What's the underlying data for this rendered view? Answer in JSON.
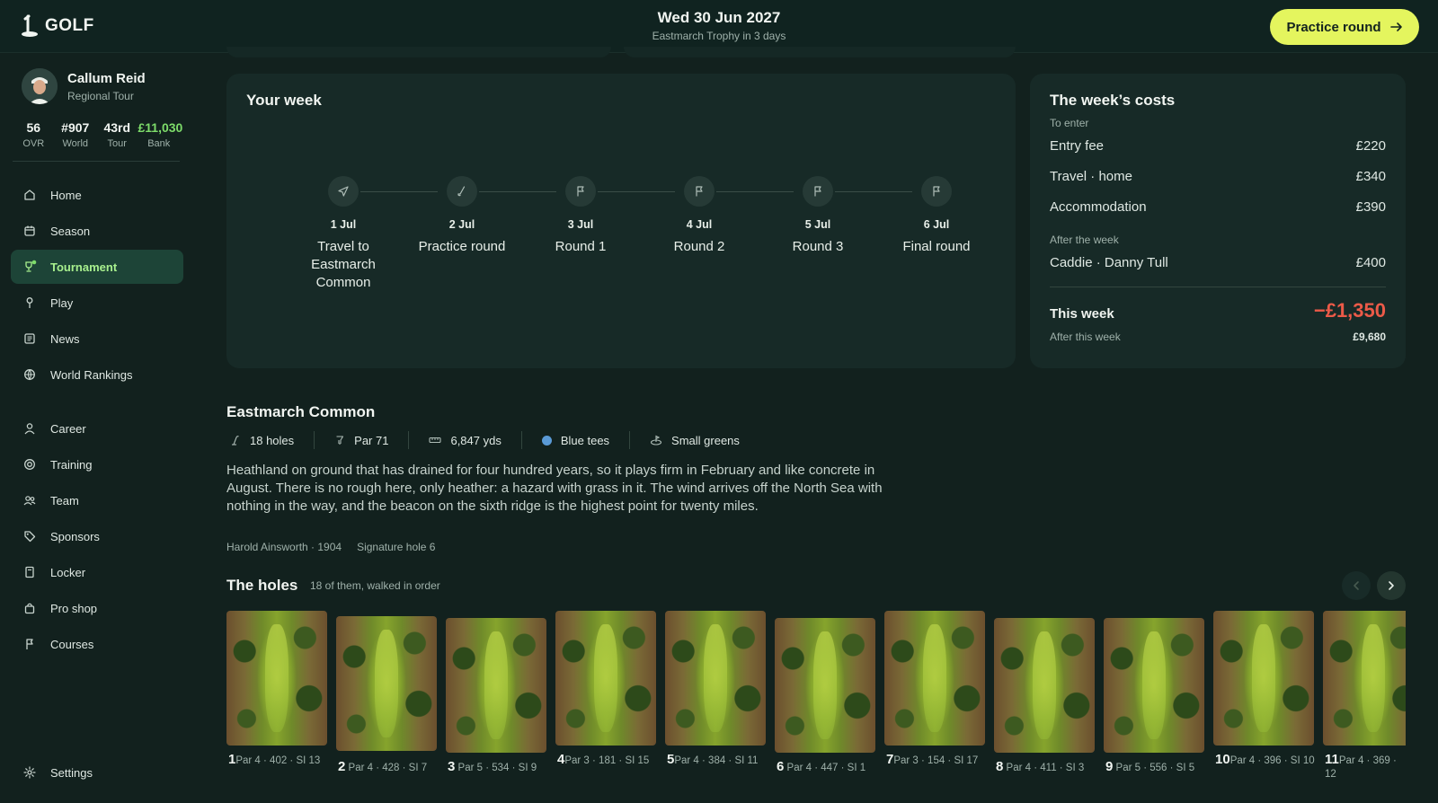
{
  "app": {
    "logo_text": "GOLF"
  },
  "header": {
    "date": "Wed 30 Jun 2027",
    "subtitle": "Eastmarch Trophy in 3 days",
    "cta_label": "Practice round"
  },
  "profile": {
    "name": "Callum Reid",
    "tour": "Regional Tour",
    "stats": [
      {
        "value": "56",
        "label": "OVR"
      },
      {
        "value": "#907",
        "label": "World"
      },
      {
        "value": "43rd",
        "label": "Tour"
      },
      {
        "value": "£11,030",
        "label": "Bank"
      }
    ]
  },
  "nav": {
    "items": [
      {
        "label": "Home",
        "icon": "home-icon"
      },
      {
        "label": "Season",
        "icon": "calendar-icon"
      },
      {
        "label": "Tournament",
        "icon": "trophy-icon",
        "active": true
      },
      {
        "label": "Play",
        "icon": "tee-icon"
      },
      {
        "label": "News",
        "icon": "newspaper-icon"
      },
      {
        "label": "World Rankings",
        "icon": "globe-icon"
      },
      {
        "label": "Career",
        "icon": "user-icon"
      },
      {
        "label": "Training",
        "icon": "target-icon"
      },
      {
        "label": "Team",
        "icon": "users-icon"
      },
      {
        "label": "Sponsors",
        "icon": "tag-icon"
      },
      {
        "label": "Locker",
        "icon": "locker-icon"
      },
      {
        "label": "Pro shop",
        "icon": "bag-icon"
      },
      {
        "label": "Courses",
        "icon": "flag-icon"
      }
    ],
    "settings_label": "Settings"
  },
  "week": {
    "title": "Your week",
    "steps": [
      {
        "date": "1 Jul",
        "label": "Travel to Eastmarch Common",
        "icon": "plane-icon"
      },
      {
        "date": "2 Jul",
        "label": "Practice round",
        "icon": "club-icon"
      },
      {
        "date": "3 Jul",
        "label": "Round 1",
        "icon": "flag-icon"
      },
      {
        "date": "4 Jul",
        "label": "Round 2",
        "icon": "flag-icon"
      },
      {
        "date": "5 Jul",
        "label": "Round 3",
        "icon": "flag-icon"
      },
      {
        "date": "6 Jul",
        "label": "Final round",
        "icon": "flag-icon"
      }
    ]
  },
  "costs": {
    "title": "The week’s costs",
    "to_enter_label": "To enter",
    "enter_rows": [
      {
        "label": "Entry fee",
        "value": "£220"
      },
      {
        "label": "Travel · home",
        "value": "£340"
      },
      {
        "label": "Accommodation",
        "value": "£390"
      }
    ],
    "after_label": "After the week",
    "after_rows": [
      {
        "label": "Caddie · Danny Tull",
        "value": "£400"
      }
    ],
    "total_label": "This week",
    "total_value": "−£1,350",
    "after_week_label": "After this week",
    "after_week_value": "£9,680",
    "colors": {
      "total": "#ec5a48"
    }
  },
  "course": {
    "name": "Eastmarch Common",
    "chips": [
      {
        "label": "18 holes",
        "icon": "tee-icon"
      },
      {
        "label": "Par 71",
        "icon": "cup-icon"
      },
      {
        "label": "6,847 yds",
        "icon": "ruler-icon"
      },
      {
        "label": "Blue tees",
        "icon": "blue-dot"
      },
      {
        "label": "Small greens",
        "icon": "green-icon"
      }
    ],
    "description": "Heathland on ground that has drained for four hundred years, so it plays firm in February and like concrete in August. There is no rough here, only heather: a hazard with grass in it. The wind arrives off the North Sea with nothing in the way, and the beacon on the sixth ridge is the highest point for twenty miles.",
    "architect": "Harold Ainsworth · 1904",
    "signature": "Signature hole 6"
  },
  "holes": {
    "title": "The holes",
    "subtitle": "18 of them, walked in order",
    "items": [
      {
        "num": "1",
        "info": "Par 4 · 402 · SI 13"
      },
      {
        "num": "2",
        "info": "Par 4 · 428 · SI 7"
      },
      {
        "num": "3",
        "info": "Par 5 · 534 · SI 9"
      },
      {
        "num": "4",
        "info": "Par 3 · 181 · SI 15"
      },
      {
        "num": "5",
        "info": "Par 4 · 384 · SI 11"
      },
      {
        "num": "6",
        "info": "Par 4 · 447 · SI 1"
      },
      {
        "num": "7",
        "info": "Par 3 · 154 · SI 17"
      },
      {
        "num": "8",
        "info": "Par 4 · 411 · SI 3"
      },
      {
        "num": "9",
        "info": "Par 5 · 556 · SI 5"
      },
      {
        "num": "10",
        "info": "Par 4 · 396 · SI 10"
      },
      {
        "num": "11",
        "info": "Par 4 · 369 · 12"
      }
    ]
  },
  "colors": {
    "accent": "#e4f55e",
    "active_nav": "#1d4437",
    "bank": "#7ddc6a"
  }
}
